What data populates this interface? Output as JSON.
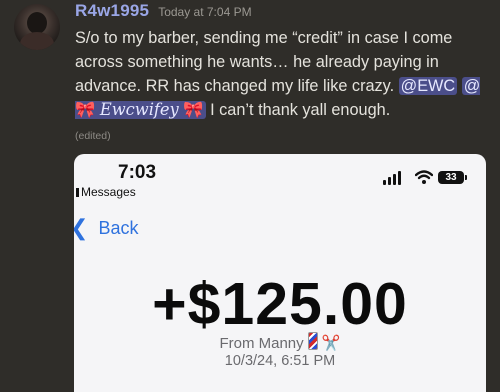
{
  "message": {
    "username": "R4w1995",
    "timestamp": "Today at 7:04 PM",
    "text_before": "S/o to my barber, sending me “credit” in case I come across something he wants… he already paying in advance. RR has changed my life like crazy. ",
    "mention_ewc": "@EWC",
    "mention_wifey_prefix": "@",
    "bow_emoji": "🎀",
    "mention_wifey_name": "Ewcwifey",
    "text_after": " I can’t thank yall enough.",
    "edited_label": "(edited)"
  },
  "attachment": {
    "status_time": "7:03",
    "back_app": "Messages",
    "battery": "33",
    "nav_back_label": "Back",
    "amount": "+$125.00",
    "from_label": "From Manny",
    "scissors_emoji": "✂️",
    "date": "10/3/24, 6:51 PM"
  },
  "colors": {
    "background": "#2f2d29",
    "username": "#9aa6e6",
    "mention_bg": "#4b4e8a",
    "link_blue": "#2f72de"
  },
  "icons": [
    "barber-pole-icon",
    "scissors-icon",
    "wifi-icon",
    "signal-icon",
    "battery-icon",
    "back-chevron-icon"
  ]
}
